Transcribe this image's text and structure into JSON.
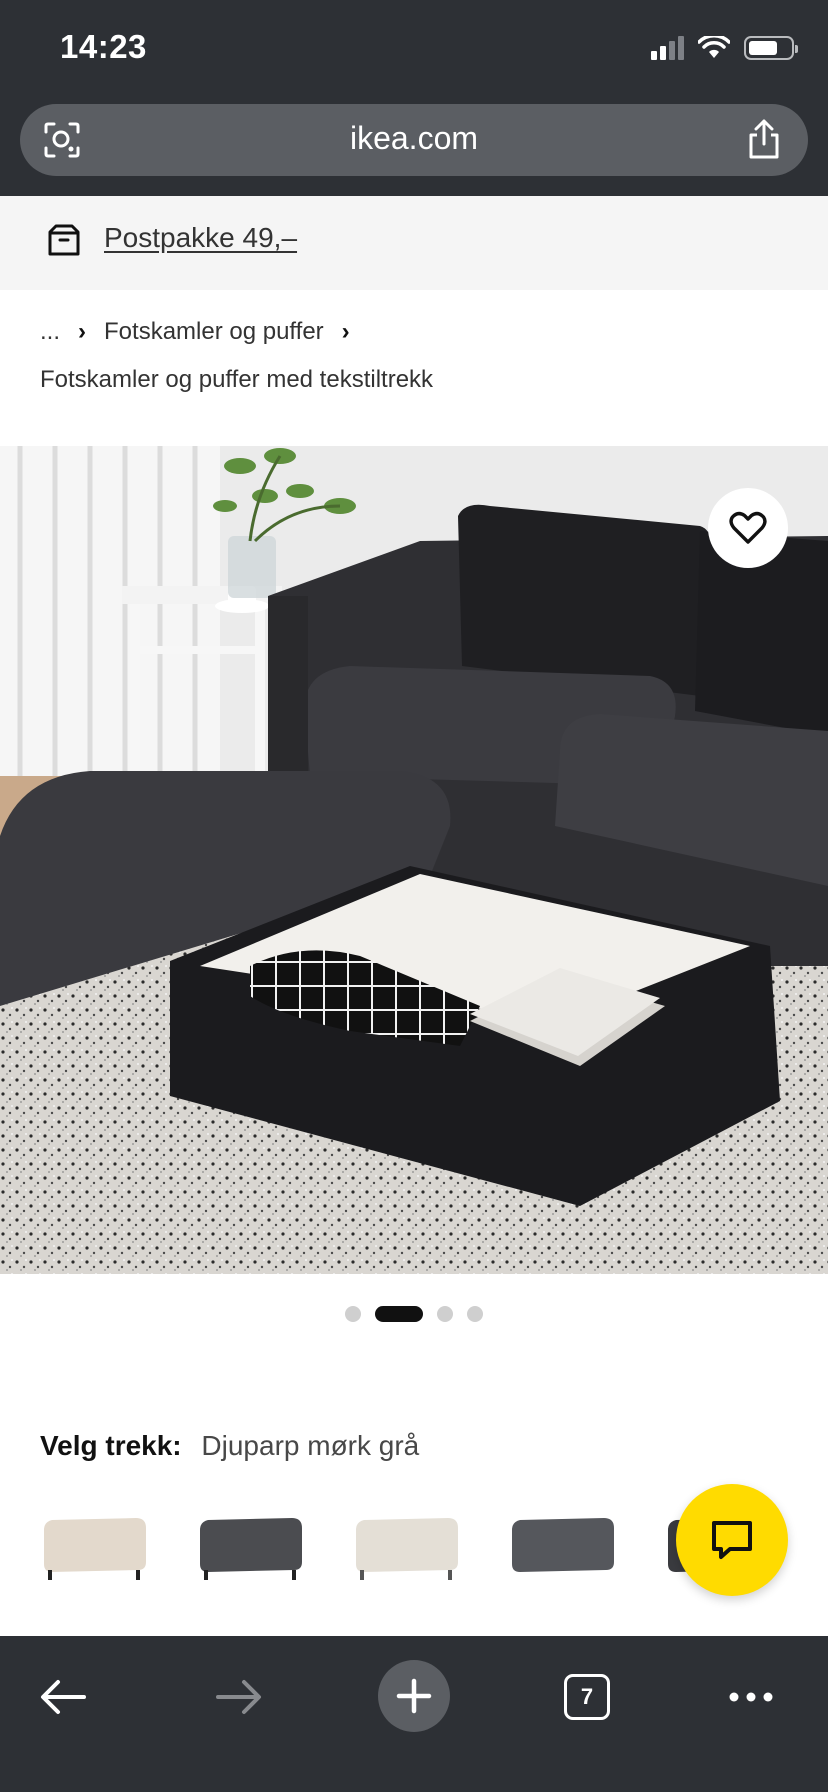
{
  "status_bar": {
    "time": "14:23"
  },
  "browser": {
    "url": "ikea.com",
    "tab_count": "7"
  },
  "shipping_banner": {
    "text": "Postpakke 49,–"
  },
  "breadcrumb": {
    "ellipsis": "...",
    "category": "Fotskamler og puffer",
    "subcategory": "Fotskamler og puffer med tekstiltrekk"
  },
  "gallery": {
    "image_count": 4,
    "active_index": 1
  },
  "cover": {
    "label": "Velg trekk:",
    "value": "Djuparp mørk grå",
    "swatches": [
      {
        "color": "#e3d9cc"
      },
      {
        "color": "#4b4c50"
      },
      {
        "color": "#e4dfd6"
      },
      {
        "color": "#55575c"
      },
      {
        "color": "#3a3b3f"
      }
    ]
  },
  "colors": {
    "chrome": "#2d3035",
    "chat_fab": "#ffdb00"
  },
  "icons": [
    "lens-icon",
    "share-icon",
    "box-icon",
    "heart-icon",
    "chat-icon",
    "back-arrow-icon",
    "forward-arrow-icon",
    "plus-icon",
    "tabs-icon",
    "more-icon"
  ]
}
